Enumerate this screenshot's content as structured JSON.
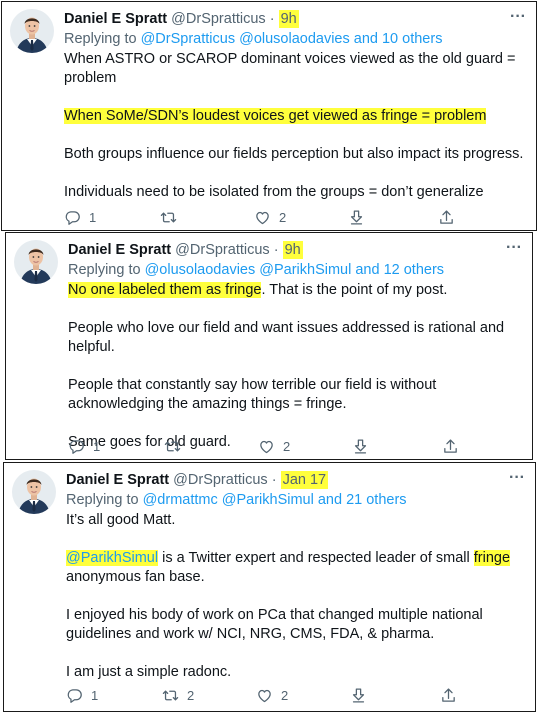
{
  "tweets": [
    {
      "name": "Daniel E Spratt",
      "handle": "@DrSpratticus",
      "dot": "·",
      "time": "9h",
      "replying_prefix": "Replying to",
      "replying_to": "@DrSpratticus @olusolaodavies and 10 others",
      "paragraphs": [
        {
          "segments": [
            {
              "text": "When ASTRO or SCAROP dominant voices viewed as the old guard = problem",
              "hl": false
            }
          ]
        },
        {
          "segments": [
            {
              "text": "When SoMe/SDN’s loudest voices get viewed as fringe = problem",
              "hl": true
            }
          ]
        },
        {
          "segments": [
            {
              "text": "Both groups influence our fields perception but also impact its progress.",
              "hl": false
            }
          ]
        },
        {
          "segments": [
            {
              "text": "Individuals need to be isolated from the groups = don’t generalize",
              "hl": false
            }
          ]
        }
      ],
      "replies": "1",
      "retweets": "",
      "likes": "2"
    },
    {
      "name": "Daniel E Spratt",
      "handle": "@DrSpratticus",
      "dot": "·",
      "time": "9h",
      "replying_prefix": "Replying to",
      "replying_to": "@olusolaodavies @ParikhSimul and 12 others",
      "paragraphs": [
        {
          "segments": [
            {
              "text": "No one labeled them as fringe",
              "hl": true
            },
            {
              "text": ". That is the point of my post.",
              "hl": false
            }
          ]
        },
        {
          "segments": [
            {
              "text": "People who love our field and want issues addressed is rational and helpful.",
              "hl": false
            }
          ]
        },
        {
          "segments": [
            {
              "text": "People that constantly say how terrible our field is without acknowledging the amazing things = fringe.",
              "hl": false
            }
          ]
        },
        {
          "segments": [
            {
              "text": "Same goes for old guard.",
              "hl": false
            }
          ]
        }
      ],
      "replies": "1",
      "retweets": "",
      "likes": "2"
    },
    {
      "name": "Daniel E Spratt",
      "handle": "@DrSpratticus",
      "dot": "·",
      "time": "Jan 17",
      "replying_prefix": "Replying to",
      "replying_to": "@drmattmc @ParikhSimul and 21 others",
      "paragraphs": [
        {
          "segments": [
            {
              "text": "It’s all good Matt.",
              "hl": false
            }
          ]
        },
        {
          "segments": [
            {
              "text": "@ParikhSimul",
              "hl": true,
              "link": true
            },
            {
              "text": " is a Twitter expert and respected leader of small ",
              "hl": false
            },
            {
              "text": "fringe",
              "hl": true
            },
            {
              "text": " anonymous fan base.",
              "hl": false
            }
          ]
        },
        {
          "segments": [
            {
              "text": "I enjoyed his body of work on PCa that changed multiple national guidelines and work w/ NCI, NRG, CMS, FDA, & pharma.",
              "hl": false
            }
          ]
        },
        {
          "segments": [
            {
              "text": "I am just a simple radonc.",
              "hl": false
            }
          ]
        }
      ],
      "replies": "1",
      "retweets": "2",
      "likes": "2"
    }
  ],
  "more_glyph": "···",
  "colors": {
    "highlight": "#ffff3c",
    "link": "#1d9bf0",
    "muted": "#536471",
    "text": "#0f1419",
    "frame": "#1a1a1a"
  },
  "icons": [
    "avatar",
    "more-icon",
    "reply-icon",
    "retweet-icon",
    "like-icon",
    "share-icon",
    "upload-icon"
  ]
}
